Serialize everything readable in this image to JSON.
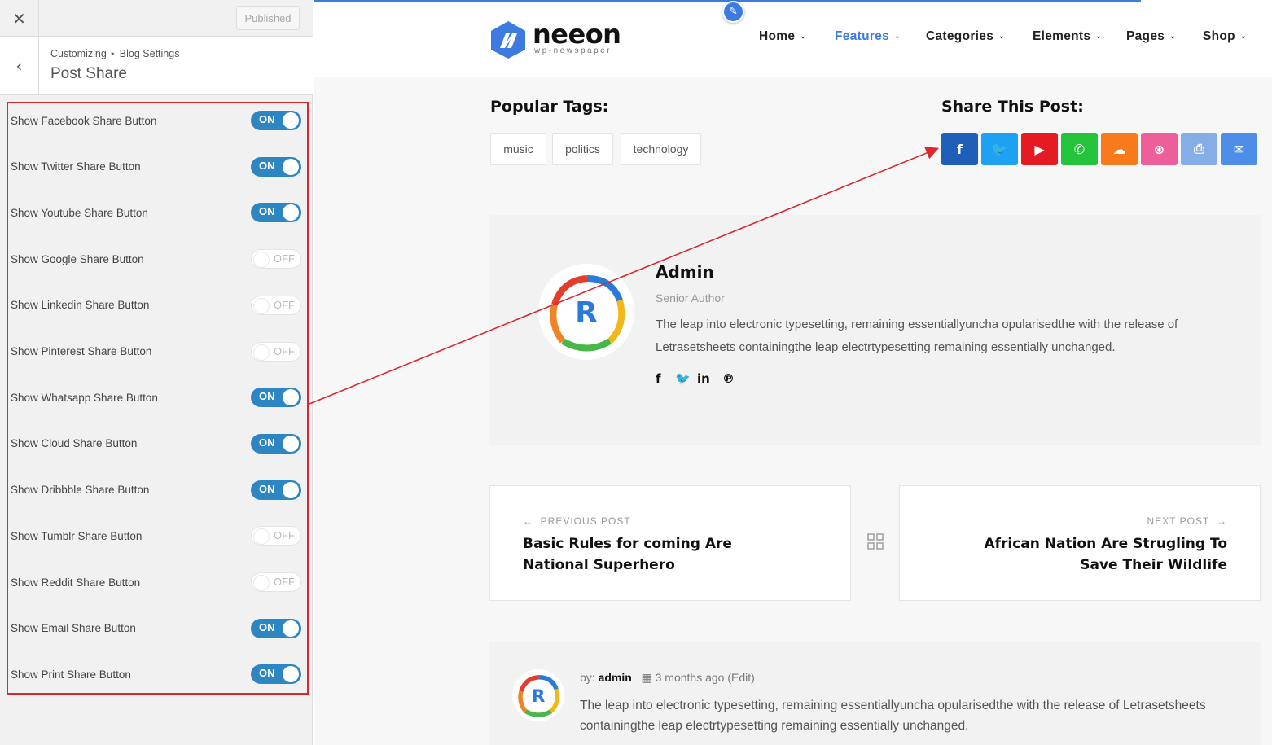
{
  "customizer": {
    "close_icon": "close-icon",
    "published_label": "Published",
    "back_icon": "chevron-left-icon",
    "breadcrumb": [
      "Customizing",
      "Blog Settings"
    ],
    "section_title": "Post Share",
    "highlight_color": "#d9262f",
    "toggle_on_color": "#2d86c2",
    "settings": [
      {
        "label": "Show Facebook Share Button",
        "state": "ON"
      },
      {
        "label": "Show Twitter Share Button",
        "state": "ON"
      },
      {
        "label": "Show Youtube Share Button",
        "state": "ON"
      },
      {
        "label": "Show Google Share Button",
        "state": "OFF"
      },
      {
        "label": "Show Linkedin Share Button",
        "state": "OFF"
      },
      {
        "label": "Show Pinterest Share Button",
        "state": "OFF"
      },
      {
        "label": "Show Whatsapp Share Button",
        "state": "ON"
      },
      {
        "label": "Show Cloud Share Button",
        "state": "ON"
      },
      {
        "label": "Show Dribbble Share Button",
        "state": "ON"
      },
      {
        "label": "Show Tumblr Share Button",
        "state": "OFF"
      },
      {
        "label": "Show Reddit Share Button",
        "state": "OFF"
      },
      {
        "label": "Show Email Share Button",
        "state": "ON"
      },
      {
        "label": "Show Print Share Button",
        "state": "ON"
      }
    ]
  },
  "site": {
    "logo_text": "neeon",
    "logo_tagline": "wp-newspaper",
    "accent_color": "#3d7be0",
    "nav": [
      {
        "label": "Home",
        "active": false
      },
      {
        "label": "Features",
        "active": true
      },
      {
        "label": "Categories",
        "active": false
      },
      {
        "label": "Elements",
        "active": false
      },
      {
        "label": "Pages",
        "active": false
      },
      {
        "label": "Shop",
        "active": false
      }
    ]
  },
  "post": {
    "tags_heading": "Popular Tags:",
    "tags": [
      "music",
      "politics",
      "technology"
    ],
    "share_heading": "Share This Post:",
    "share_buttons": [
      {
        "icon": "facebook-icon",
        "glyph": "f",
        "color": "#1e5fb8"
      },
      {
        "icon": "twitter-icon",
        "glyph": "🐦",
        "color": "#1da1f2"
      },
      {
        "icon": "youtube-icon",
        "glyph": "▶",
        "color": "#e41b23"
      },
      {
        "icon": "whatsapp-icon",
        "glyph": "✆",
        "color": "#25c23b"
      },
      {
        "icon": "cloud-icon",
        "glyph": "☁",
        "color": "#f87a1d"
      },
      {
        "icon": "dribbble-icon",
        "glyph": "⊛",
        "color": "#ec5f9a"
      },
      {
        "icon": "print-icon",
        "glyph": "⎙",
        "color": "#86aee6"
      },
      {
        "icon": "email-icon",
        "glyph": "✉",
        "color": "#4d8ee8"
      }
    ],
    "author": {
      "name": "Admin",
      "role": "Senior Author",
      "bio": "The leap into electronic typesetting, remaining essentiallyuncha opularisedthe with the release of Letrasetsheets containingthe leap electrtypesetting remaining essentially unchanged.",
      "social": [
        {
          "icon": "facebook-icon",
          "glyph": "f"
        },
        {
          "icon": "twitter-icon",
          "glyph": "🐦"
        },
        {
          "icon": "linkedin-icon",
          "glyph": "in"
        },
        {
          "icon": "pinterest-icon",
          "glyph": "℗"
        }
      ]
    },
    "prev": {
      "kicker": "PREVIOUS POST",
      "title": "Basic Rules for coming Are National Superhero"
    },
    "next": {
      "kicker": "NEXT POST",
      "title": "African Nation Are Strugling To Save Their Wildlife"
    },
    "comment": {
      "by_label": "by:",
      "author": "admin",
      "time": "3 months ago",
      "edit": "(Edit)",
      "text": "The leap into electronic typesetting, remaining essentiallyuncha opularisedthe with the release of Letrasetsheets containingthe leap electrtypesetting remaining essentially unchanged."
    }
  }
}
